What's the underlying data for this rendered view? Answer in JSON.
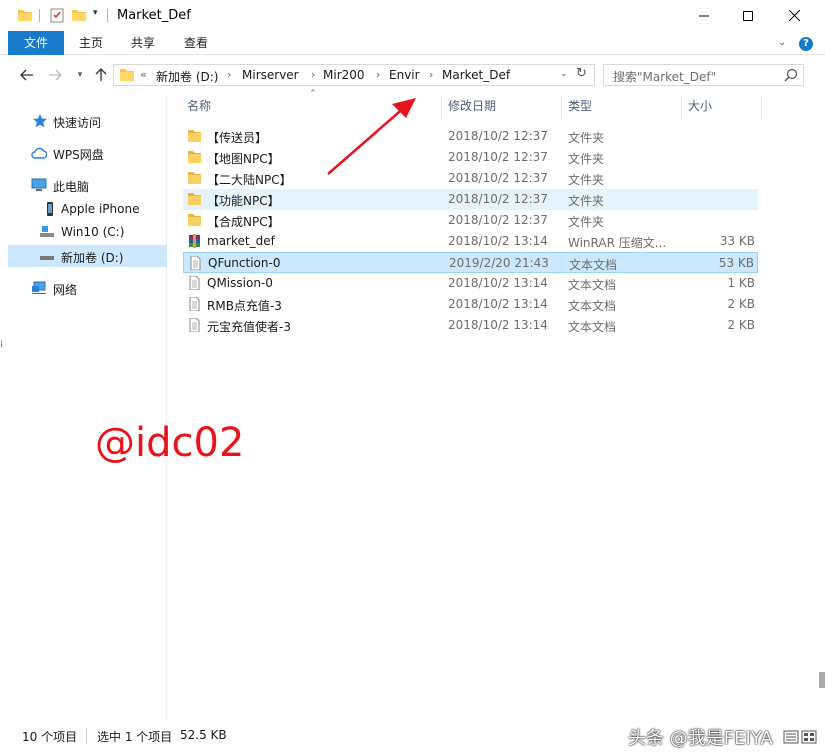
{
  "window": {
    "title": "Market_Def"
  },
  "ribbon": {
    "tabs": [
      "文件",
      "主页",
      "共享",
      "查看"
    ],
    "help": "?"
  },
  "address": {
    "overflow": "«",
    "crumbs": [
      "新加卷 (D:)",
      "Mirserver",
      "Mir200",
      "Envir",
      "Market_Def"
    ],
    "separator": "›"
  },
  "search": {
    "placeholder": "搜索\"Market_Def\""
  },
  "sidebar": {
    "items": [
      {
        "label": "快速访问",
        "icon": "star-icon"
      },
      {
        "label": "WPS网盘",
        "icon": "cloud-icon"
      },
      {
        "label": "此电脑",
        "icon": "computer-icon"
      },
      {
        "label": "Apple iPhone",
        "icon": "phone-icon"
      },
      {
        "label": "Win10 (C:)",
        "icon": "drive-icon"
      },
      {
        "label": "新加卷 (D:)",
        "icon": "drive-icon",
        "selected": true
      },
      {
        "label": "网络",
        "icon": "network-icon"
      }
    ]
  },
  "columns": {
    "name": "名称",
    "date": "修改日期",
    "type": "类型",
    "size": "大小"
  },
  "files": [
    {
      "name": "【传送员】",
      "date": "2018/10/2 12:37",
      "type": "文件夹",
      "size": "",
      "icon": "folder-icon"
    },
    {
      "name": "【地图NPC】",
      "date": "2018/10/2 12:37",
      "type": "文件夹",
      "size": "",
      "icon": "folder-icon"
    },
    {
      "name": "【二大陆NPC】",
      "date": "2018/10/2 12:37",
      "type": "文件夹",
      "size": "",
      "icon": "folder-icon"
    },
    {
      "name": "【功能NPC】",
      "date": "2018/10/2 12:37",
      "type": "文件夹",
      "size": "",
      "icon": "folder-icon",
      "state": "hover"
    },
    {
      "name": "【合成NPC】",
      "date": "2018/10/2 12:37",
      "type": "文件夹",
      "size": "",
      "icon": "folder-icon"
    },
    {
      "name": "market_def",
      "date": "2018/10/2 13:14",
      "type": "WinRAR 压缩文...",
      "size": "33 KB",
      "icon": "archive-icon"
    },
    {
      "name": "QFunction-0",
      "date": "2019/2/20 21:43",
      "type": "文本文档",
      "size": "53 KB",
      "icon": "text-file-icon",
      "state": "selected"
    },
    {
      "name": "QMission-0",
      "date": "2018/10/2 13:14",
      "type": "文本文档",
      "size": "1 KB",
      "icon": "text-file-icon"
    },
    {
      "name": "RMB点充值-3",
      "date": "2018/10/2 13:14",
      "type": "文本文档",
      "size": "2 KB",
      "icon": "text-file-icon"
    },
    {
      "name": "元宝充值使者-3",
      "date": "2018/10/2 13:14",
      "type": "文本文档",
      "size": "2 KB",
      "icon": "text-file-icon"
    }
  ],
  "annotation": {
    "watermark": "@idc02",
    "arrow_color": "#e8141b"
  },
  "status": {
    "count": "10 个项目",
    "selected": "选中 1 个项目",
    "size": "52.5 KB",
    "credit": "头条 @我是FEIYA"
  },
  "colors": {
    "accent": "#1979ca",
    "selected_bg": "#cce8ff",
    "hover_bg": "#e5f3ff",
    "folder": "#f4c64e"
  }
}
